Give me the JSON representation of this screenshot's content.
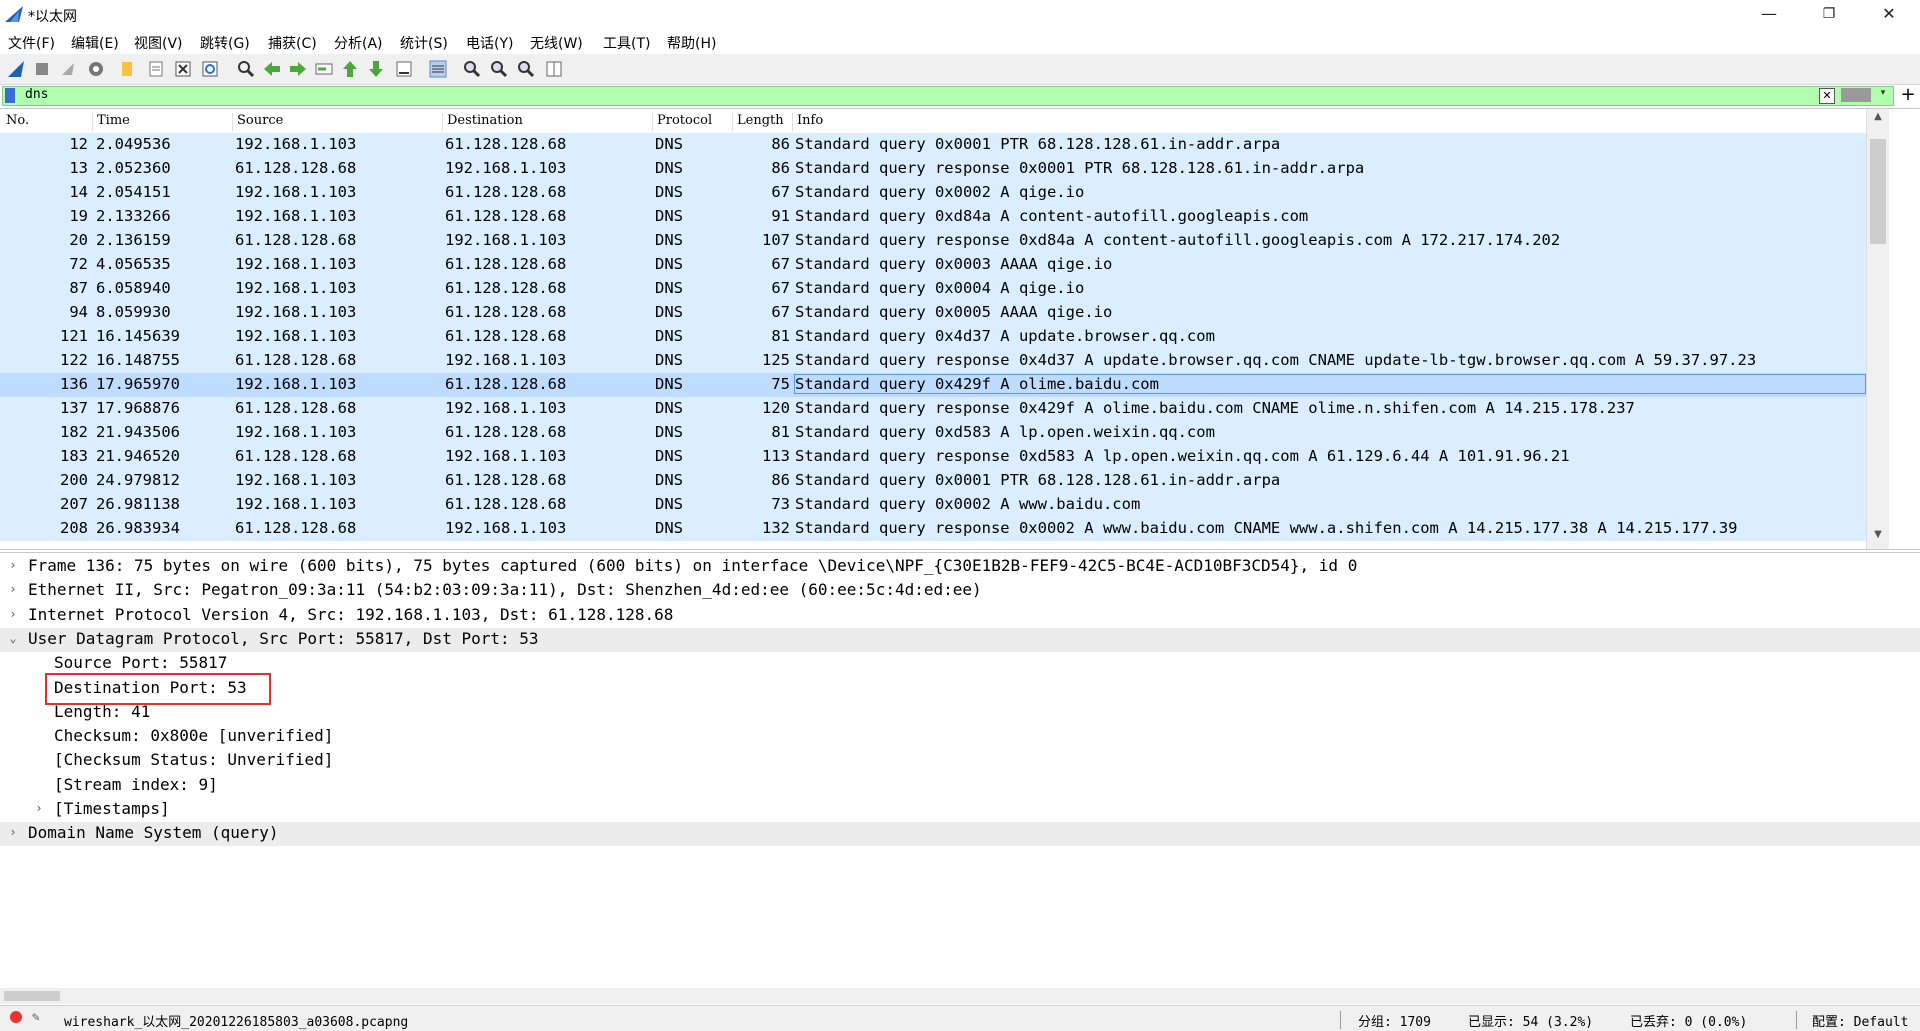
{
  "window": {
    "title": "*以太网",
    "controls": {
      "minimize": "—",
      "restore": "❐",
      "close": "✕"
    }
  },
  "menu": [
    "文件(F)",
    "编辑(E)",
    "视图(V)",
    "跳转(G)",
    "捕获(C)",
    "分析(A)",
    "统计(S)",
    "电话(Y)",
    "无线(W)",
    "工具(T)",
    "帮助(H)"
  ],
  "toolbar_icons": [
    "shark-fin-start-icon",
    "stop-icon",
    "restart-icon",
    "options-gear-icon",
    "open-folder-icon",
    "save-file-icon",
    "close-file-icon",
    "reload-icon",
    "find-icon",
    "go-back-icon",
    "go-forward-icon",
    "go-to-packet-icon",
    "first-packet-icon",
    "last-packet-icon",
    "autoscroll-icon",
    "colorize-icon",
    "zoom-in-icon",
    "zoom-out-icon",
    "normal-size-icon",
    "resize-columns-icon"
  ],
  "filter": {
    "value": "dns",
    "accent": "#afffaf"
  },
  "packet_list": {
    "columns": [
      "No.",
      "Time",
      "Source",
      "Destination",
      "Protocol",
      "Length",
      "Info"
    ],
    "rows": [
      {
        "no": "12",
        "time": "2.049536",
        "src": "192.168.1.103",
        "dst": "61.128.128.68",
        "proto": "DNS",
        "len": "86",
        "info": "Standard query 0x0001 PTR 68.128.128.61.in-addr.arpa"
      },
      {
        "no": "13",
        "time": "2.052360",
        "src": "61.128.128.68",
        "dst": "192.168.1.103",
        "proto": "DNS",
        "len": "86",
        "info": "Standard query response 0x0001 PTR 68.128.128.61.in-addr.arpa"
      },
      {
        "no": "14",
        "time": "2.054151",
        "src": "192.168.1.103",
        "dst": "61.128.128.68",
        "proto": "DNS",
        "len": "67",
        "info": "Standard query 0x0002 A qige.io"
      },
      {
        "no": "19",
        "time": "2.133266",
        "src": "192.168.1.103",
        "dst": "61.128.128.68",
        "proto": "DNS",
        "len": "91",
        "info": "Standard query 0xd84a A content-autofill.googleapis.com"
      },
      {
        "no": "20",
        "time": "2.136159",
        "src": "61.128.128.68",
        "dst": "192.168.1.103",
        "proto": "DNS",
        "len": "107",
        "info": "Standard query response 0xd84a A content-autofill.googleapis.com A 172.217.174.202"
      },
      {
        "no": "72",
        "time": "4.056535",
        "src": "192.168.1.103",
        "dst": "61.128.128.68",
        "proto": "DNS",
        "len": "67",
        "info": "Standard query 0x0003 AAAA qige.io"
      },
      {
        "no": "87",
        "time": "6.058940",
        "src": "192.168.1.103",
        "dst": "61.128.128.68",
        "proto": "DNS",
        "len": "67",
        "info": "Standard query 0x0004 A qige.io"
      },
      {
        "no": "94",
        "time": "8.059930",
        "src": "192.168.1.103",
        "dst": "61.128.128.68",
        "proto": "DNS",
        "len": "67",
        "info": "Standard query 0x0005 AAAA qige.io"
      },
      {
        "no": "121",
        "time": "16.145639",
        "src": "192.168.1.103",
        "dst": "61.128.128.68",
        "proto": "DNS",
        "len": "81",
        "info": "Standard query 0x4d37 A update.browser.qq.com"
      },
      {
        "no": "122",
        "time": "16.148755",
        "src": "61.128.128.68",
        "dst": "192.168.1.103",
        "proto": "DNS",
        "len": "125",
        "info": "Standard query response 0x4d37 A update.browser.qq.com CNAME update-lb-tgw.browser.qq.com A 59.37.97.23"
      },
      {
        "no": "136",
        "time": "17.965970",
        "src": "192.168.1.103",
        "dst": "61.128.128.68",
        "proto": "DNS",
        "len": "75",
        "info": "Standard query 0x429f A olime.baidu.com",
        "selected": true
      },
      {
        "no": "137",
        "time": "17.968876",
        "src": "61.128.128.68",
        "dst": "192.168.1.103",
        "proto": "DNS",
        "len": "120",
        "info": "Standard query response 0x429f A olime.baidu.com CNAME olime.n.shifen.com A 14.215.178.237"
      },
      {
        "no": "182",
        "time": "21.943506",
        "src": "192.168.1.103",
        "dst": "61.128.128.68",
        "proto": "DNS",
        "len": "81",
        "info": "Standard query 0xd583 A lp.open.weixin.qq.com"
      },
      {
        "no": "183",
        "time": "21.946520",
        "src": "61.128.128.68",
        "dst": "192.168.1.103",
        "proto": "DNS",
        "len": "113",
        "info": "Standard query response 0xd583 A lp.open.weixin.qq.com A 61.129.6.44 A 101.91.96.21"
      },
      {
        "no": "200",
        "time": "24.979812",
        "src": "192.168.1.103",
        "dst": "61.128.128.68",
        "proto": "DNS",
        "len": "86",
        "info": "Standard query 0x0001 PTR 68.128.128.61.in-addr.arpa"
      },
      {
        "no": "207",
        "time": "26.981138",
        "src": "192.168.1.103",
        "dst": "61.128.128.68",
        "proto": "DNS",
        "len": "73",
        "info": "Standard query 0x0002 A www.baidu.com"
      },
      {
        "no": "208",
        "time": "26.983934",
        "src": "61.128.128.68",
        "dst": "192.168.1.103",
        "proto": "DNS",
        "len": "132",
        "info": "Standard query response 0x0002 A www.baidu.com CNAME www.a.shifen.com A 14.215.177.38 A 14.215.177.39"
      }
    ]
  },
  "details": [
    {
      "text": "Frame 136: 75 bytes on wire (600 bits), 75 bytes captured (600 bits) on interface \\Device\\NPF_{C30E1B2B-FEF9-42C5-BC4E-ACD10BF3CD54}, id 0",
      "level": 0,
      "expander": "›",
      "shaded": false
    },
    {
      "text": "Ethernet II, Src: Pegatron_09:3a:11 (54:b2:03:09:3a:11), Dst: Shenzhen_4d:ed:ee (60:ee:5c:4d:ed:ee)",
      "level": 0,
      "expander": "›",
      "shaded": false
    },
    {
      "text": "Internet Protocol Version 4, Src: 192.168.1.103, Dst: 61.128.128.68",
      "level": 0,
      "expander": "›",
      "shaded": false
    },
    {
      "text": "User Datagram Protocol, Src Port: 55817, Dst Port: 53",
      "level": 0,
      "expander": "⌄",
      "shaded": true
    },
    {
      "text": "Source Port: 55817",
      "level": 1,
      "expander": "",
      "shaded": false
    },
    {
      "text": "Destination Port: 53",
      "level": 1,
      "expander": "",
      "shaded": false
    },
    {
      "text": "Length: 41",
      "level": 1,
      "expander": "",
      "shaded": false
    },
    {
      "text": "Checksum: 0x800e [unverified]",
      "level": 1,
      "expander": "",
      "shaded": false
    },
    {
      "text": "[Checksum Status: Unverified]",
      "level": 1,
      "expander": "",
      "shaded": false
    },
    {
      "text": "[Stream index: 9]",
      "level": 1,
      "expander": "",
      "shaded": false
    },
    {
      "text": "[Timestamps]",
      "level": 1,
      "expander": "›",
      "shaded": false
    },
    {
      "text": "Domain Name System (query)",
      "level": 0,
      "expander": "›",
      "shaded": true
    }
  ],
  "status": {
    "file": "wireshark_以太网_20201226185803_a03608.pcapng",
    "packets": "分组: 1709",
    "displayed": "已显示: 54 (3.2%)",
    "dropped": "已丢弃: 0 (0.0%)",
    "profile": "配置: Default"
  }
}
